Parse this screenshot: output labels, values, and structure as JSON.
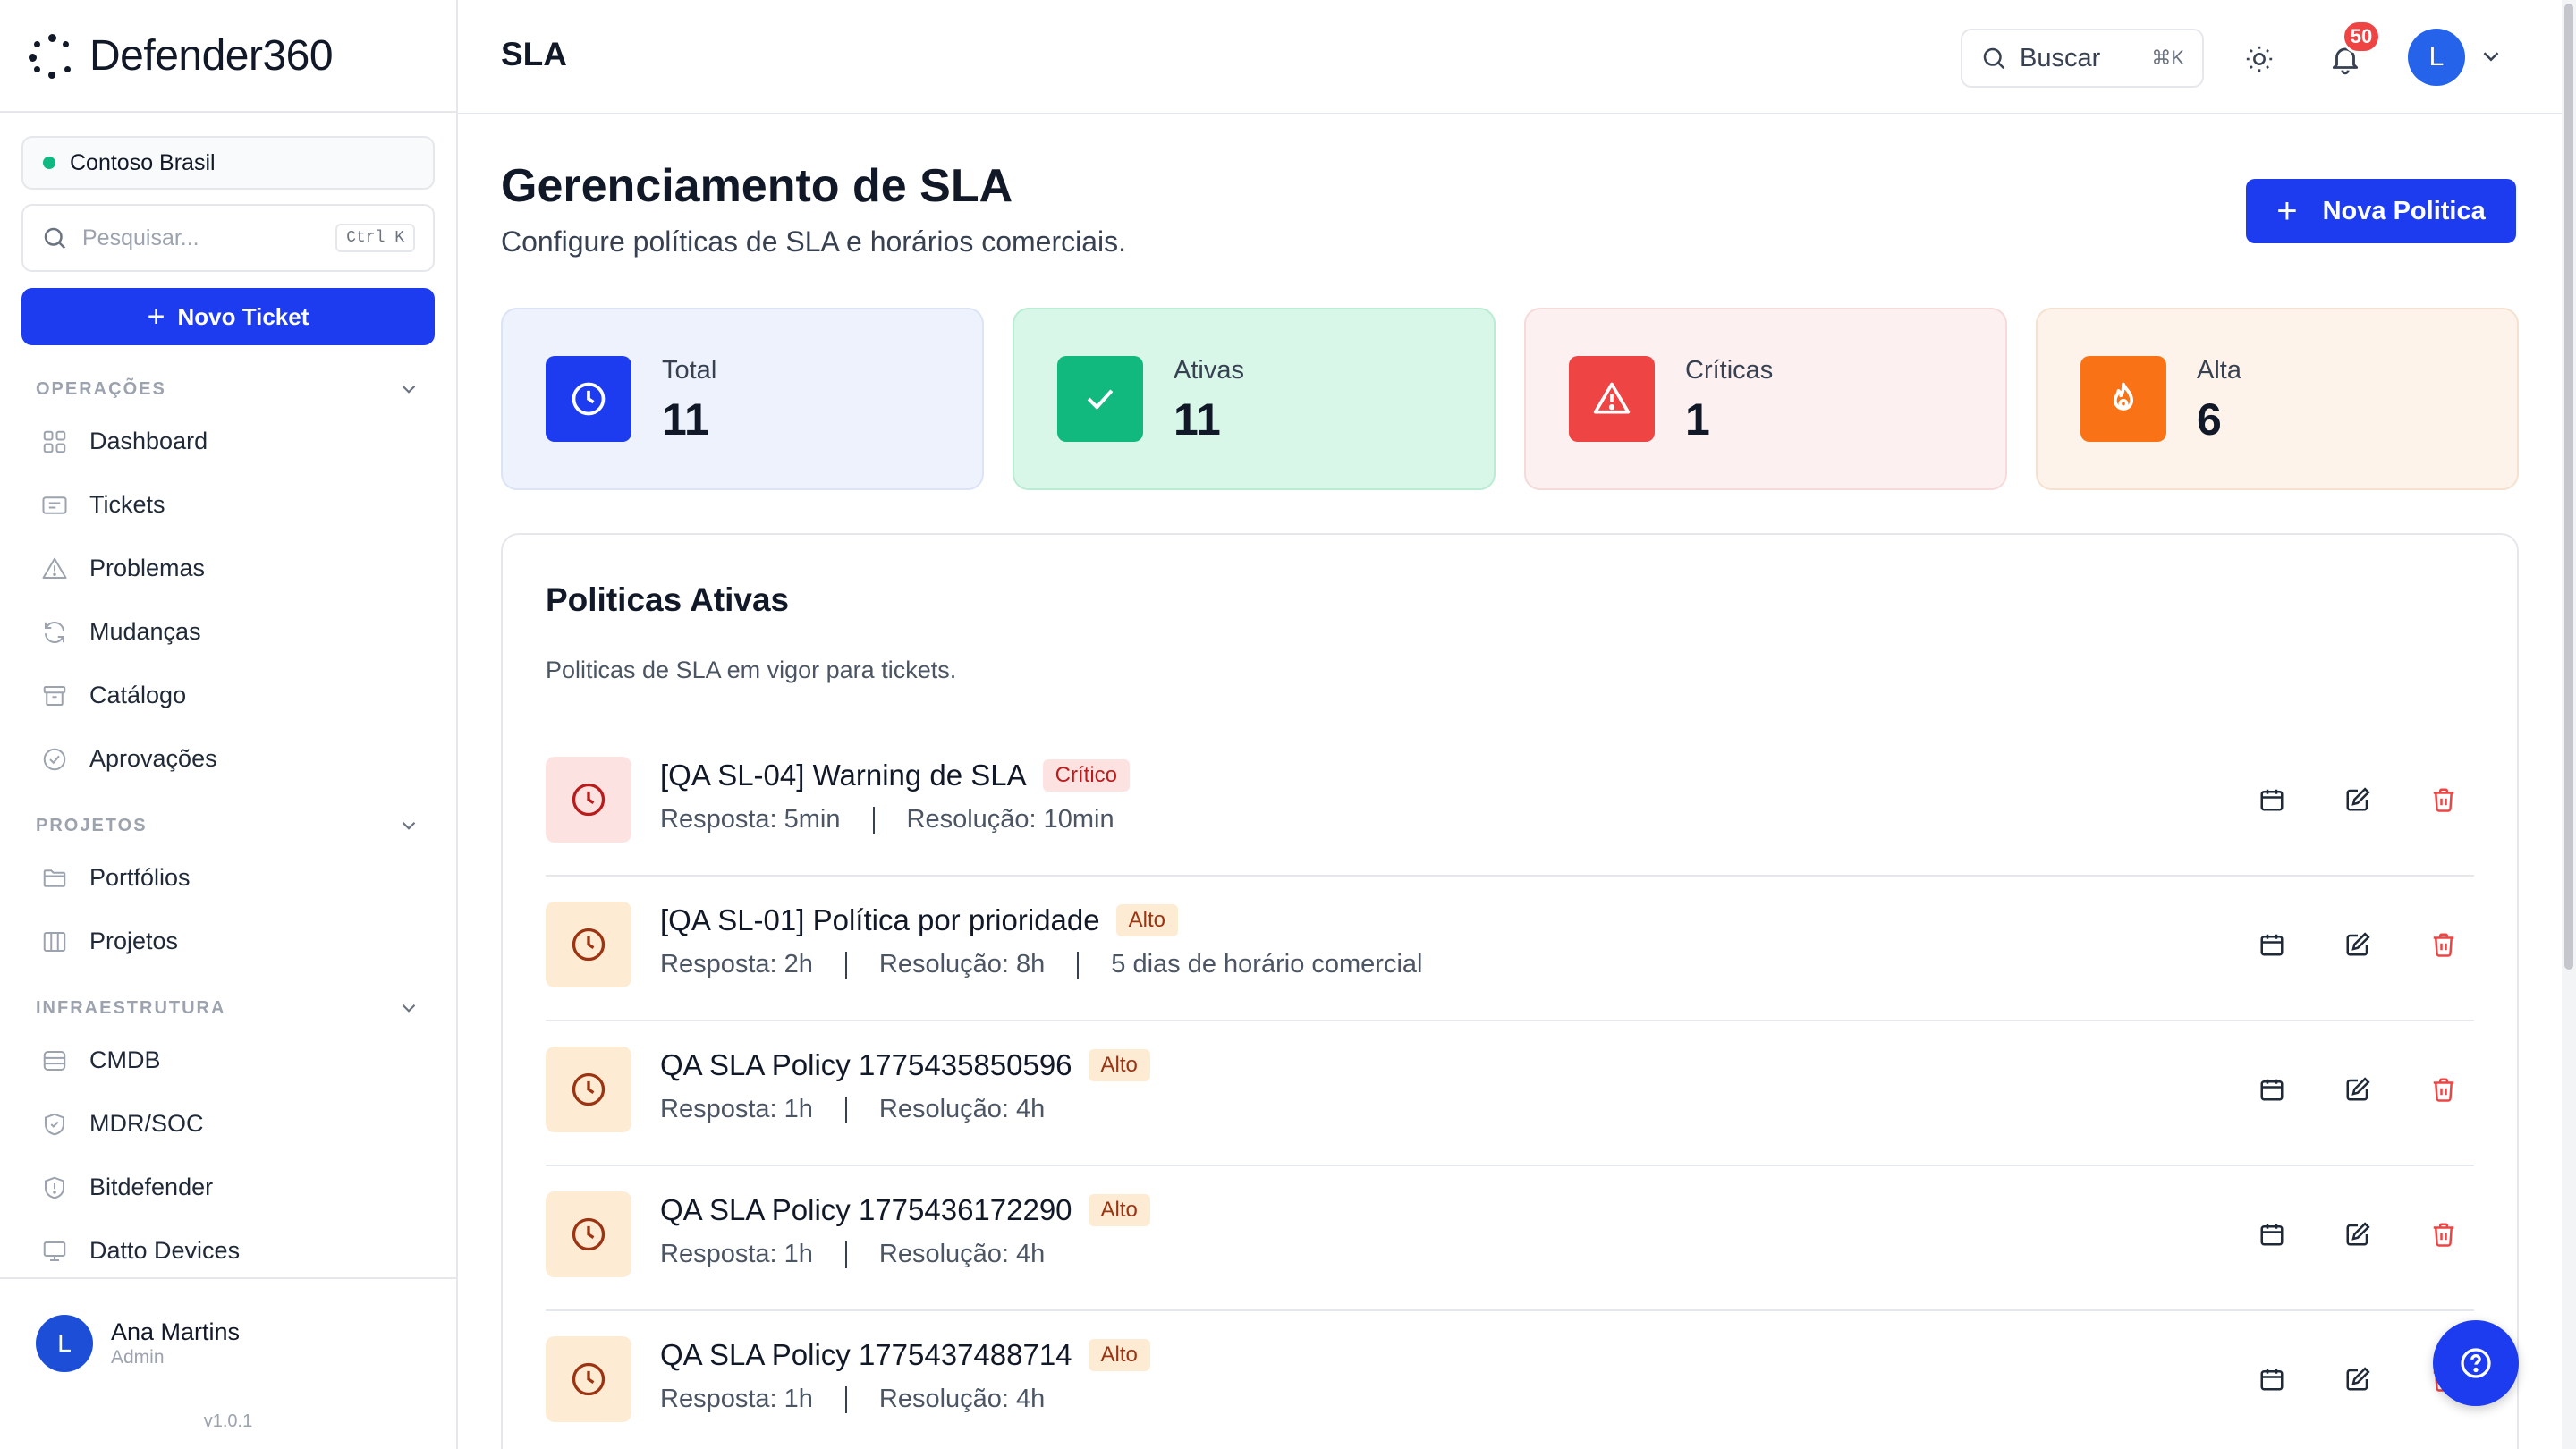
{
  "brand": {
    "name": "Defender360"
  },
  "sidebar": {
    "org": "Contoso Brasil",
    "search_placeholder": "Pesquisar...",
    "search_shortcut": "Ctrl K",
    "new_ticket": "Novo Ticket",
    "sections": [
      {
        "title": "OPERAÇÕES",
        "items": [
          "Dashboard",
          "Tickets",
          "Problemas",
          "Mudanças",
          "Catálogo",
          "Aprovações"
        ]
      },
      {
        "title": "PROJETOS",
        "items": [
          "Portfólios",
          "Projetos"
        ]
      },
      {
        "title": "INFRAESTRUTURA",
        "items": [
          "CMDB",
          "MDR/SOC",
          "Bitdefender",
          "Datto Devices"
        ]
      }
    ],
    "user": {
      "initial": "L",
      "name": "Ana Martins",
      "role": "Admin"
    },
    "version": "v1.0.1"
  },
  "header": {
    "page_label": "SLA",
    "search_label": "Buscar",
    "search_shortcut": "⌘K",
    "notifications": "50",
    "avatar_initial": "L"
  },
  "main": {
    "title": "Gerenciamento de SLA",
    "subtitle": "Configure políticas de SLA e horários comerciais.",
    "new_policy": "Nova Politica",
    "stats": [
      {
        "label": "Total",
        "value": "11"
      },
      {
        "label": "Ativas",
        "value": "11"
      },
      {
        "label": "Críticas",
        "value": "1"
      },
      {
        "label": "Alta",
        "value": "6"
      }
    ],
    "card": {
      "title": "Politicas Ativas",
      "subtitle": "Politicas de SLA em vigor para tickets.",
      "policies": [
        {
          "name": "[QA SL-04] Warning de SLA",
          "priority": "Crítico",
          "response": "Resposta: 5min",
          "resolution": "Resolução: 10min",
          "extra": ""
        },
        {
          "name": "[QA SL-01] Política por prioridade",
          "priority": "Alto",
          "response": "Resposta: 2h",
          "resolution": "Resolução: 8h",
          "extra": "5 dias de horário comercial"
        },
        {
          "name": "QA SLA Policy 1775435850596",
          "priority": "Alto",
          "response": "Resposta: 1h",
          "resolution": "Resolução: 4h",
          "extra": ""
        },
        {
          "name": "QA SLA Policy 1775436172290",
          "priority": "Alto",
          "response": "Resposta: 1h",
          "resolution": "Resolução: 4h",
          "extra": ""
        },
        {
          "name": "QA SLA Policy 1775437488714",
          "priority": "Alto",
          "response": "Resposta: 1h",
          "resolution": "Resolução: 4h",
          "extra": ""
        }
      ]
    }
  },
  "colors": {
    "primary": "#1d3cf0",
    "success": "#10b981",
    "danger": "#ef4444",
    "warning": "#f97316"
  }
}
